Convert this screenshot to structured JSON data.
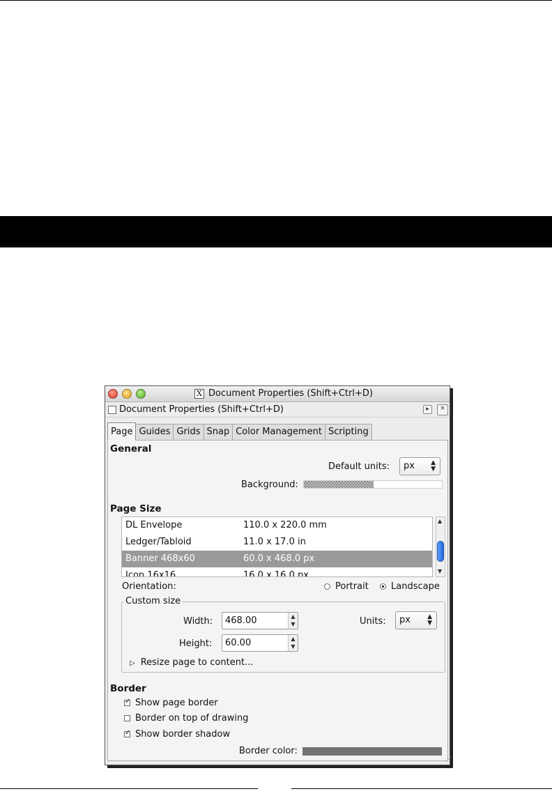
{
  "window": {
    "title": "Document Properties (Shift+Ctrl+D)",
    "dock_title": "Document Properties (Shift+Ctrl+D)"
  },
  "tabs": [
    "Page",
    "Guides",
    "Grids",
    "Snap",
    "Color Management",
    "Scripting"
  ],
  "general": {
    "heading": "General",
    "default_units_label": "Default units:",
    "default_units_value": "px",
    "background_label": "Background:"
  },
  "page_size": {
    "heading": "Page Size",
    "rows": [
      {
        "name": "DL Envelope",
        "size": "110.0 x 220.0 mm"
      },
      {
        "name": "Ledger/Tabloid",
        "size": "11.0 x 17.0 in"
      },
      {
        "name": "Banner 468x60",
        "size": "60.0 x 468.0 px"
      },
      {
        "name": "Icon 16x16",
        "size": "16.0 x 16.0 px"
      }
    ],
    "orientation_label": "Orientation:",
    "portrait_label": "Portrait",
    "landscape_label": "Landscape",
    "custom_size_label": "Custom size",
    "width_label": "Width:",
    "width_value": "468.00",
    "height_label": "Height:",
    "height_value": "60.00",
    "units_label": "Units:",
    "units_value": "px",
    "resize_label": "Resize page to content..."
  },
  "border": {
    "heading": "Border",
    "show_page_border": "Show page border",
    "border_on_top": "Border on top of drawing",
    "show_border_shadow": "Show border shadow",
    "border_color_label": "Border color:"
  },
  "colors": {
    "selected_row": "#9a9a9a",
    "border_color": "#747474",
    "scroll_thumb": "#2f74e0"
  }
}
